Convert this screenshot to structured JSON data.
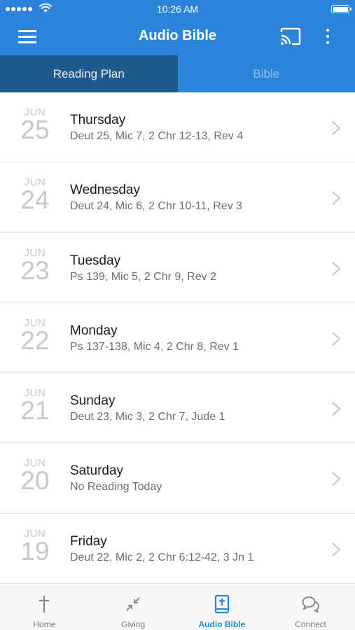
{
  "status_bar": {
    "time": "10:26 AM"
  },
  "header": {
    "title": "Audio Bible"
  },
  "tabs": [
    {
      "label": "Reading Plan",
      "active": true
    },
    {
      "label": "Bible",
      "active": false
    }
  ],
  "readings": [
    {
      "month": "JUN",
      "day": "25",
      "weekday": "Thursday",
      "passages": "Deut 25, Mic 7, 2 Chr 12-13, Rev 4"
    },
    {
      "month": "JUN",
      "day": "24",
      "weekday": "Wednesday",
      "passages": "Deut 24, Mic 6, 2 Chr 10-11, Rev 3"
    },
    {
      "month": "JUN",
      "day": "23",
      "weekday": "Tuesday",
      "passages": "Ps 139, Mic 5, 2 Chr 9, Rev 2"
    },
    {
      "month": "JUN",
      "day": "22",
      "weekday": "Monday",
      "passages": "Ps 137-138, Mic 4, 2 Chr 8, Rev 1"
    },
    {
      "month": "JUN",
      "day": "21",
      "weekday": "Sunday",
      "passages": "Deut 23, Mic 3, 2 Chr 7, Jude 1"
    },
    {
      "month": "JUN",
      "day": "20",
      "weekday": "Saturday",
      "passages": "No Reading Today"
    },
    {
      "month": "JUN",
      "day": "19",
      "weekday": "Friday",
      "passages": "Deut 22, Mic 2, 2 Chr 6:12-42, 3 Jn 1"
    }
  ],
  "bottom_nav": [
    {
      "label": "Home",
      "icon": "cross-icon",
      "active": false
    },
    {
      "label": "Giving",
      "icon": "compress-arrows-icon",
      "active": false
    },
    {
      "label": "Audio Bible",
      "icon": "bible-book-icon",
      "active": true
    },
    {
      "label": "Connect",
      "icon": "chat-bubbles-icon",
      "active": false
    }
  ],
  "colors": {
    "primary": "#2a84d9",
    "tab_active": "#1f5a8c",
    "date_gray": "#c8c8c8"
  }
}
